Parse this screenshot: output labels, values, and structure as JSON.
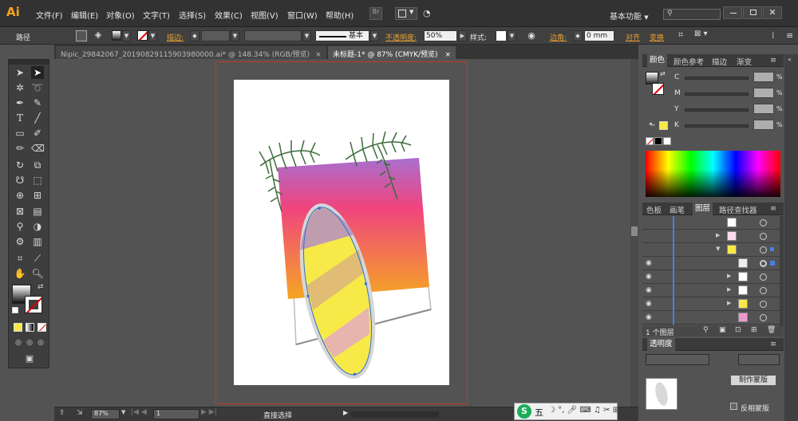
{
  "app": {
    "logo": "Ai",
    "workspace": "基本功能",
    "br_label": "Br"
  },
  "menu": [
    "文件(F)",
    "编辑(E)",
    "对象(O)",
    "文字(T)",
    "选择(S)",
    "效果(C)",
    "视图(V)",
    "窗口(W)",
    "帮助(H)"
  ],
  "control_bar": {
    "object_type": "路径",
    "stroke_label": "描边:",
    "stroke_style": "基本",
    "opacity_label": "不透明度:",
    "opacity_value": "50%",
    "style_label": "样式:",
    "corner_label": "边角:",
    "corner_value": "0 mm",
    "align_label": "对齐",
    "transform_label": "变换"
  },
  "tabs": [
    {
      "label": "Nipic_29842067_20190829115903980000.ai* @ 148.34% (RGB/预览)",
      "close": "×"
    },
    {
      "label": "未标题-1* @ 87% (CMYK/预览)",
      "close": "×"
    }
  ],
  "tools": [
    "selection-tool",
    "direct-selection-tool",
    "magic-wand-tool",
    "lasso-tool",
    "pen-tool",
    "curvature-tool",
    "type-tool",
    "line-tool",
    "rectangle-tool",
    "paintbrush-tool",
    "pencil-tool",
    "eraser-tool",
    "rotate-tool",
    "scale-tool",
    "warp-tool",
    "free-transform-tool",
    "shape-builder-tool",
    "perspective-grid-tool",
    "mesh-tool",
    "gradient-tool",
    "eyedropper-tool",
    "blend-tool",
    "symbol-sprayer-tool",
    "column-graph-tool",
    "artboard-tool",
    "slice-tool",
    "hand-tool",
    "zoom-tool"
  ],
  "color_panel": {
    "tabs": [
      "颜色",
      "颜色参考",
      "描边",
      "渐变"
    ],
    "channels": [
      "C",
      "M",
      "Y",
      "K"
    ],
    "unit": "%"
  },
  "layers_panel": {
    "tabs": [
      "色板",
      "画笔",
      "图层",
      "路径查找器"
    ],
    "footer": "1 个图层",
    "rows": 8
  },
  "transparency_panel": {
    "tab": "透明度",
    "make_mask": "制作蒙版",
    "invert_mask": "反相蒙版"
  },
  "status": {
    "zoom": "87%",
    "artboard": "1",
    "tool_name": "直接选择"
  },
  "ime": {
    "label": "五"
  },
  "colors": {
    "menubar_bg": "#323232",
    "canvas_bg": "#535353",
    "accent": "#f7a21b",
    "artboard_border": "#c0392b",
    "gradient_top": "#a86fd0",
    "gradient_mid": "#f0447e",
    "gradient_bottom": "#f5a623",
    "board_yellow": "#f7ea48"
  }
}
